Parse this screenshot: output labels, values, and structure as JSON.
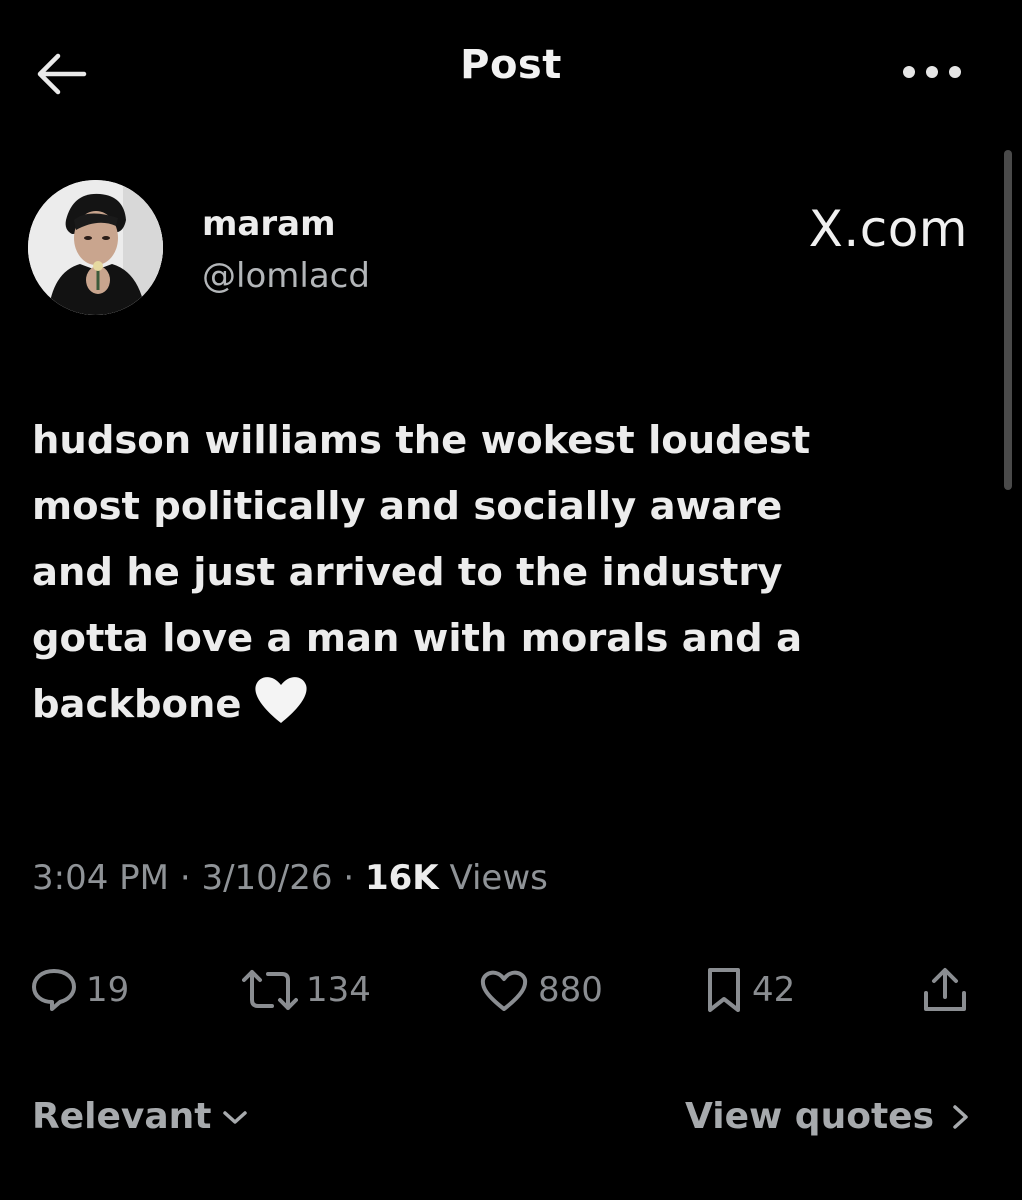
{
  "header": {
    "title": "Post",
    "back_icon": "arrow-left-icon",
    "more_icon": "more-horizontal-icon"
  },
  "author": {
    "name": "maram",
    "handle": "@lomlacd",
    "source": "X.com"
  },
  "post": {
    "text": "hudson williams the wokest loudest\nmost politically and socially aware\nand he just arrived to the industry\ngotta love a man with morals and a\nbackbone",
    "emoji": "🤍"
  },
  "meta": {
    "time": "3:04 PM",
    "date": "3/10/26",
    "views_count": "16K",
    "views_label": "Views",
    "separator": "·"
  },
  "actions": {
    "replies": "19",
    "reposts": "134",
    "likes": "880",
    "bookmarks": "42"
  },
  "footer": {
    "sort_label": "Relevant",
    "view_quotes_label": "View quotes"
  },
  "colors": {
    "background": "#000000",
    "text_primary": "#ececec",
    "text_secondary": "#8f9397"
  }
}
